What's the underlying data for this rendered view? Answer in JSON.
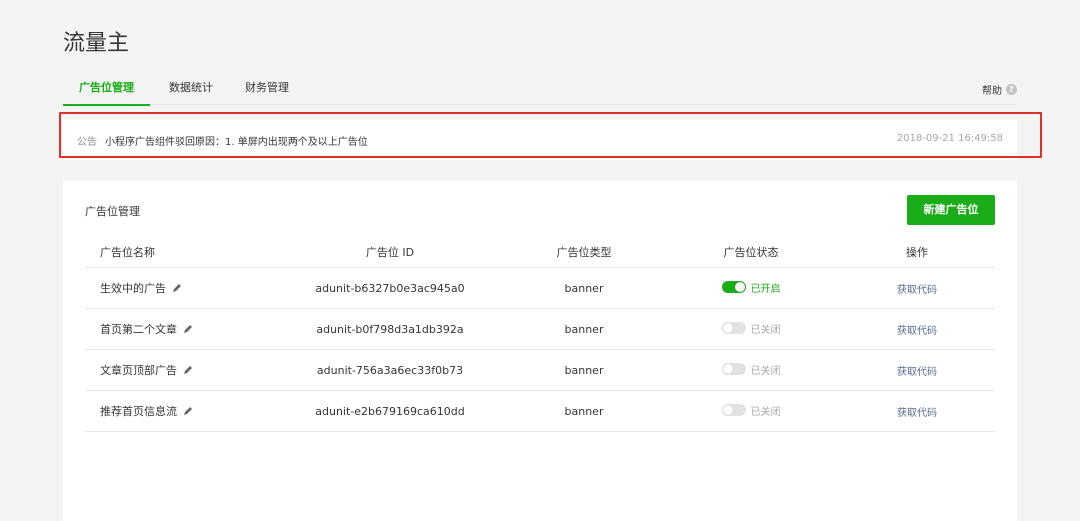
{
  "page": {
    "title": "流量主"
  },
  "tabs": [
    {
      "label": "广告位管理",
      "active": true
    },
    {
      "label": "数据统计",
      "active": false
    },
    {
      "label": "财务管理",
      "active": false
    }
  ],
  "help": {
    "label": "帮助",
    "icon": "question-circle-icon"
  },
  "notice": {
    "tag": "公告",
    "text": "小程序广告组件驳回原因：1. 单屏内出现两个及以上广告位",
    "time": "2018-09-21 16:49:58"
  },
  "card": {
    "title": "广告位管理",
    "new_button": "新建广告位",
    "columns": [
      "广告位名称",
      "广告位 ID",
      "广告位类型",
      "广告位状态",
      "操作"
    ],
    "rows": [
      {
        "name": "生效中的广告",
        "id": "adunit-b6327b0e3ac945a0",
        "type": "banner",
        "status": "已开启",
        "enabled": true,
        "action": "获取代码"
      },
      {
        "name": "首页第二个文章",
        "id": "adunit-b0f798d3a1db392a",
        "type": "banner",
        "status": "已关闭",
        "enabled": false,
        "action": "获取代码"
      },
      {
        "name": "文章页顶部广告",
        "id": "adunit-756a3a6ec33f0b73",
        "type": "banner",
        "status": "已关闭",
        "enabled": false,
        "action": "获取代码"
      },
      {
        "name": "推荐首页信息流",
        "id": "adunit-e2b679169ca610dd",
        "type": "banner",
        "status": "已关闭",
        "enabled": false,
        "action": "获取代码"
      }
    ]
  },
  "colors": {
    "accent": "#1aad19",
    "highlight_frame": "#e0302a",
    "link": "#576b95"
  }
}
